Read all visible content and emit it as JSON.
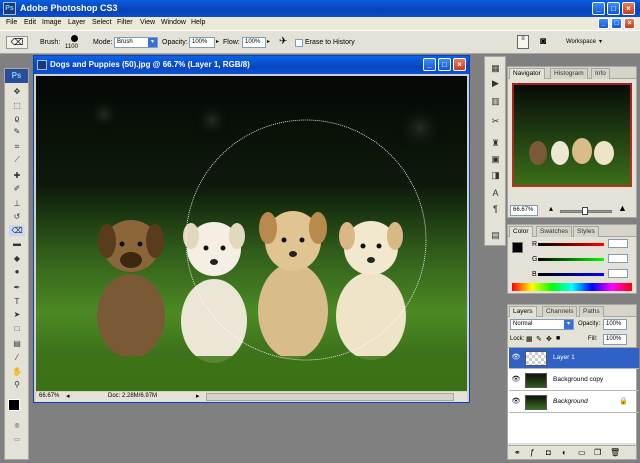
{
  "app": {
    "title": "Adobe Photoshop CS3",
    "icon_text": "Ps"
  },
  "window_controls": {
    "minimize": "_",
    "maximize": "□",
    "close": "×"
  },
  "menu": [
    "File",
    "Edit",
    "Image",
    "Layer",
    "Select",
    "Filter",
    "View",
    "Window",
    "Help"
  ],
  "options_bar": {
    "brush_label": "Brush:",
    "brush_size": "1100",
    "mode_label": "Mode:",
    "mode_value": "Brush",
    "opacity_label": "Opacity:",
    "opacity_value": "100%",
    "flow_label": "Flow:",
    "flow_value": "100%",
    "erase_history_label": "Erase to History",
    "workspace_label": "Workspace"
  },
  "toolbox": {
    "header": "Ps",
    "tools": [
      "move-tool",
      "marquee-tool",
      "lasso-tool",
      "quick-select-tool",
      "crop-tool",
      "slice-tool",
      "healing-brush-tool",
      "brush-tool",
      "clone-stamp-tool",
      "history-brush-tool",
      "eraser-tool",
      "gradient-tool",
      "blur-tool",
      "dodge-tool",
      "pen-tool",
      "type-tool",
      "path-select-tool",
      "shape-tool",
      "notes-tool",
      "eyedropper-tool",
      "hand-tool",
      "zoom-tool"
    ]
  },
  "document": {
    "title": "Dogs and Puppies (50).jpg @ 66.7% (Layer 1, RGB/8)",
    "zoom": "66.67%",
    "doc_info": "Doc: 2.28M/6.97M"
  },
  "navigator": {
    "tabs": [
      "Navigator",
      "Histogram",
      "Info"
    ],
    "zoom": "66.67%"
  },
  "color_panel": {
    "tabs": [
      "Color",
      "Swatches",
      "Styles"
    ],
    "channels": [
      {
        "label": "R",
        "color": "#d81818"
      },
      {
        "label": "G",
        "color": "#18a818"
      },
      {
        "label": "B",
        "color": "#1838d8"
      }
    ]
  },
  "layers_panel": {
    "tabs": [
      "Layers",
      "Channels",
      "Paths"
    ],
    "blend_mode": "Normal",
    "opacity_label": "Opacity:",
    "opacity_value": "100%",
    "lock_label": "Lock:",
    "fill_label": "Fill:",
    "fill_value": "100%",
    "layers": [
      {
        "name": "Layer 1",
        "selected": true
      },
      {
        "name": "Background copy",
        "selected": false
      },
      {
        "name": "Background",
        "selected": false
      }
    ]
  },
  "colors": {
    "title_bar_blue": "#0842b8",
    "chrome": "#e4e2d6",
    "selected_layer": "#3161c4"
  }
}
